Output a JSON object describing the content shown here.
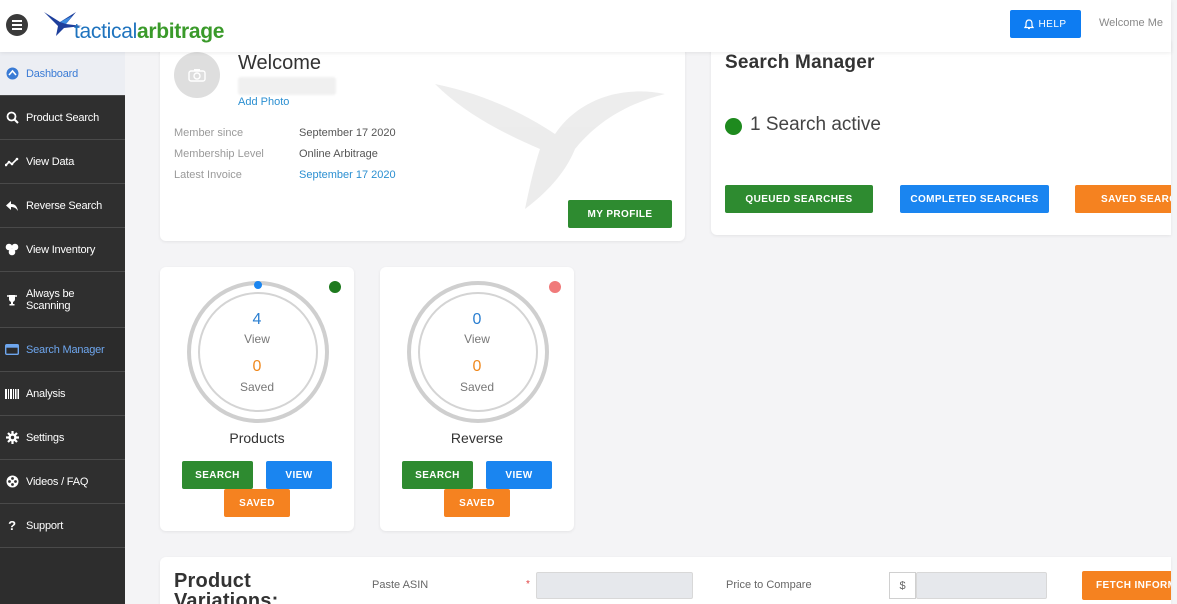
{
  "header": {
    "logo_part1": "tactical",
    "logo_part2": "arbitrage",
    "help_label": "HELP",
    "welcome_text": "Welcome Me"
  },
  "sidebar": {
    "items": [
      {
        "label": "Dashboard",
        "icon": "dashboard-icon"
      },
      {
        "label": "Product Search",
        "icon": "search-icon"
      },
      {
        "label": "View Data",
        "icon": "line-chart-icon"
      },
      {
        "label": "Reverse Search",
        "icon": "reply-arrow-icon"
      },
      {
        "label": "View Inventory",
        "icon": "boxes-icon"
      },
      {
        "label": "Always be Scanning",
        "icon": "trophy-icon"
      },
      {
        "label": "Search Manager",
        "icon": "window-icon"
      },
      {
        "label": "Analysis",
        "icon": "barcode-icon"
      },
      {
        "label": "Settings",
        "icon": "gear-icon"
      },
      {
        "label": "Videos / FAQ",
        "icon": "film-reel-icon"
      },
      {
        "label": "Support",
        "icon": "question-icon"
      }
    ]
  },
  "welcome": {
    "title": "Welcome",
    "add_photo": "Add Photo",
    "member_since_label": "Member since",
    "member_since_value": "September 17 2020",
    "level_label": "Membership Level",
    "level_value": "Online Arbitrage",
    "invoice_label": "Latest Invoice",
    "invoice_value": "September 17 2020",
    "profile_button": "MY PROFILE"
  },
  "search_manager": {
    "title": "Search Manager",
    "active_text": "1 Search active",
    "queued_button": "QUEUED SEARCHES",
    "completed_button": "COMPLETED SEARCHES",
    "saved_button": "SAVED SEARCHES"
  },
  "products": {
    "view_count": "4",
    "view_label": "View",
    "saved_count": "0",
    "saved_label": "Saved",
    "title": "Products",
    "search_button": "SEARCH",
    "view_button": "VIEW",
    "saved_button": "SAVED",
    "status_color": "#1e7a1e"
  },
  "reverse": {
    "view_count": "0",
    "view_label": "View",
    "saved_count": "0",
    "saved_label": "Saved",
    "title": "Reverse",
    "search_button": "SEARCH",
    "view_button": "VIEW",
    "saved_button": "SAVED",
    "status_color": "#f07a7a"
  },
  "product_variations": {
    "title": "Product Variations:",
    "asin_label": "Paste ASIN",
    "asin_required_mark": "*",
    "price_label": "Price to Compare",
    "price_prefix": "$",
    "fetch_button": "FETCH INFORMATION"
  },
  "colors": {
    "accent_blue": "#1a85f0",
    "green": "#2e8b30",
    "orange": "#f58220",
    "sidebar": "#2d2d2d"
  }
}
